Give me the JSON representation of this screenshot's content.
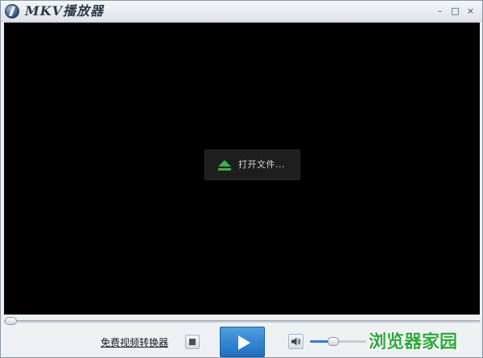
{
  "window": {
    "title": "MKV播放器",
    "controls": {
      "minimize": "–",
      "maximize": "□",
      "close": "×"
    }
  },
  "video": {
    "open_file_label": "打开文件...",
    "open_file_icon": "eject-icon"
  },
  "seek": {
    "progress": 0
  },
  "controls": {
    "converter_link": "免费视频转换器",
    "stop_icon": "stop-icon",
    "play_icon": "play-icon",
    "volume_icon": "speaker-icon",
    "volume_level": 0.4
  },
  "watermark": "浏览器家园",
  "colors": {
    "accent": "#2b7fd4",
    "play_button": "#1f6fc0",
    "open_icon": "#3db04a",
    "video_bg": "#000000",
    "watermark": "#2fa83d"
  }
}
